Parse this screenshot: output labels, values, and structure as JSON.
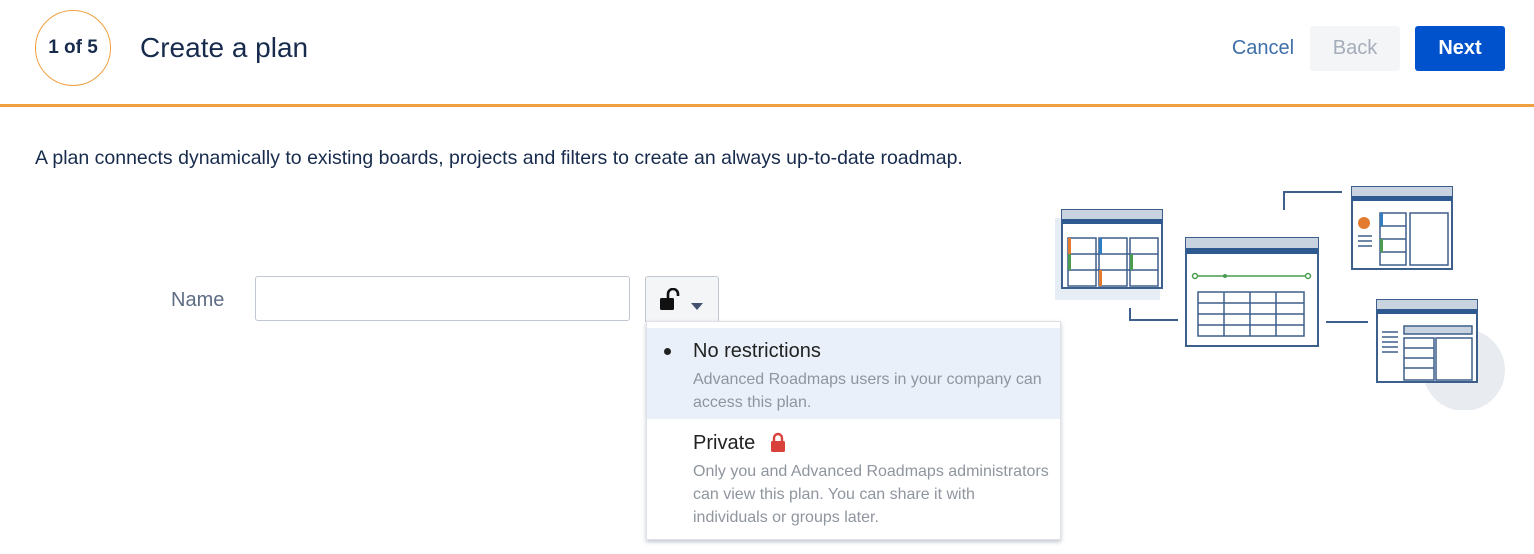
{
  "header": {
    "step": "1 of 5",
    "title": "Create a plan",
    "cancel_label": "Cancel",
    "back_label": "Back",
    "next_label": "Next"
  },
  "description": "A plan connects dynamically to existing boards, projects and filters to create an always up-to-date roadmap.",
  "form": {
    "name_label": "Name",
    "name_value": "",
    "permission_icon": "unlock-icon"
  },
  "permission_menu": {
    "options": [
      {
        "label": "No restrictions",
        "description": "Advanced Roadmaps users in your company can access this plan.",
        "selected": true
      },
      {
        "label": "Private",
        "description": "Only you and Advanced Roadmaps administrators can view this plan. You can share it with individuals or groups later.",
        "icon": "lock-icon",
        "selected": false
      }
    ]
  },
  "colors": {
    "accent_orange": "#f0a040",
    "primary_blue": "#0052cc",
    "link_blue": "#3f6ea8",
    "lock_red": "#d9413b",
    "selected_bg": "#e9f0f9"
  }
}
